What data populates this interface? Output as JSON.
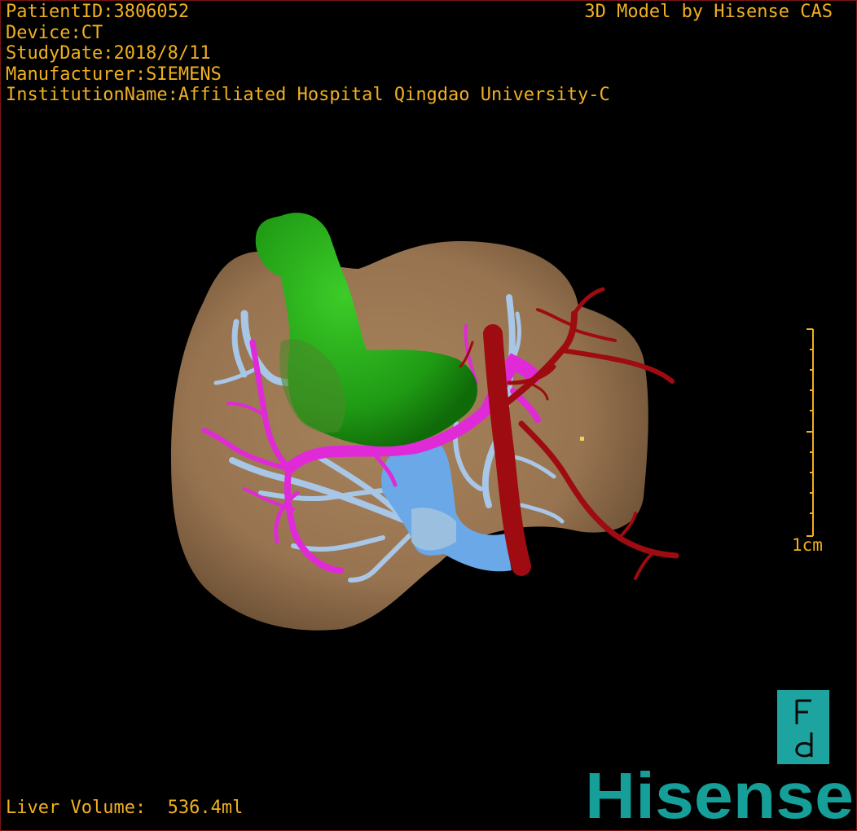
{
  "info": {
    "patient_id": "PatientID:3806052",
    "device": "Device:CT",
    "study_date": "StudyDate:2018/8/11",
    "manufacturer": "Manufacturer:SIEMENS",
    "institution": "InstitutionName:Affiliated Hospital Qingdao University-C"
  },
  "credit": "3D Model by Hisense CAS",
  "volume": "Liver Volume:  536.4ml",
  "scale": {
    "label": "1cm"
  },
  "orientation_marker": {
    "icon": "orientation-cube-icon",
    "letters": "F d"
  },
  "brand": {
    "name": "Hisense",
    "color": "#169e98"
  },
  "colors": {
    "text": "#f0b020",
    "liver": "#9a7650",
    "gallbladder": "#2ca01c",
    "portal_vein": "#e02ad8",
    "hepatic_vein": "#aac8e6",
    "vena_cava": "#6aa8e8",
    "artery": "#9e0b10"
  }
}
